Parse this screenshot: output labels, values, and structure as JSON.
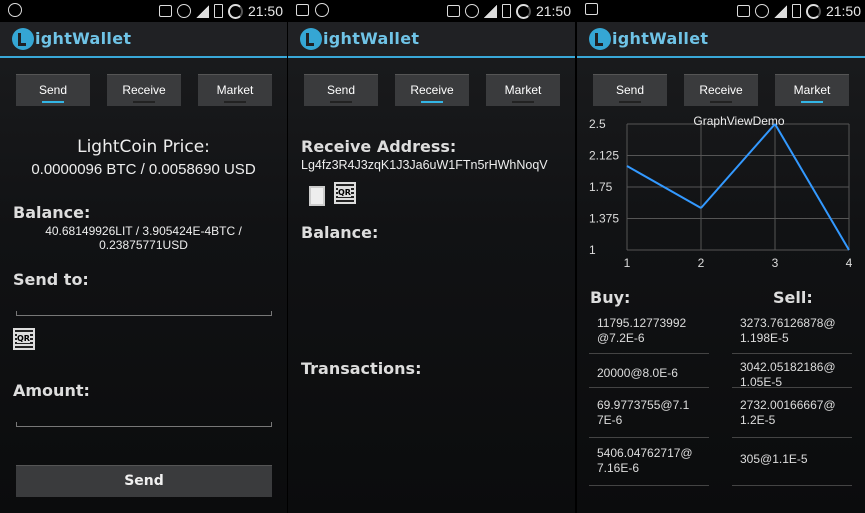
{
  "status": {
    "time": "21:50",
    "network": "E"
  },
  "app": {
    "title": "ightWallet"
  },
  "tabs": [
    "Send",
    "Receive",
    "Market"
  ],
  "send": {
    "price_label": "LightCoin Price:",
    "price_value": "0.0000096 BTC / 0.0058690 USD",
    "balance_label": "Balance:",
    "balance_line1": "40.68149926LIT / 3.905424E-4BTC /",
    "balance_line2": "0.23875771USD",
    "send_to_label": "Send to:",
    "amount_label": "Amount:",
    "send_button": "Send"
  },
  "receive": {
    "address_label": "Receive Address:",
    "address_value": "Lg4fz3R4J3zqK1J3Ja6uW1FTn5rHWhNoqV",
    "balance_label": "Balance:",
    "transactions_label": "Transactions:"
  },
  "market": {
    "buy_label": "Buy:",
    "sell_label": "Sell:",
    "buy": [
      [
        "11795.12773992",
        "@7.2E-6"
      ],
      [
        "20000@8.0E-6"
      ],
      [
        "69.9773755@7.1",
        "7E-6"
      ],
      [
        "5406.04762717@",
        "7.16E-6"
      ]
    ],
    "sell": [
      [
        "3273.76126878@",
        "1.198E-5"
      ],
      [
        "3042.05182186@",
        "1.05E-5"
      ],
      [
        "2732.00166667@",
        "1.2E-5"
      ],
      [
        "305@1.1E-5"
      ]
    ]
  },
  "chart_data": {
    "type": "line",
    "title": "GraphViewDemo",
    "x": [
      1,
      2,
      3,
      4
    ],
    "y": [
      2.0,
      1.5,
      2.5,
      1.0
    ],
    "xlim": [
      1,
      4
    ],
    "ylim": [
      1,
      2.5
    ],
    "xticks": [
      "1",
      "2",
      "3",
      "4"
    ],
    "yticks": [
      "2.5",
      "2.125",
      "1.75",
      "1.375",
      "1"
    ],
    "color": "#3399ff",
    "grid": true
  }
}
